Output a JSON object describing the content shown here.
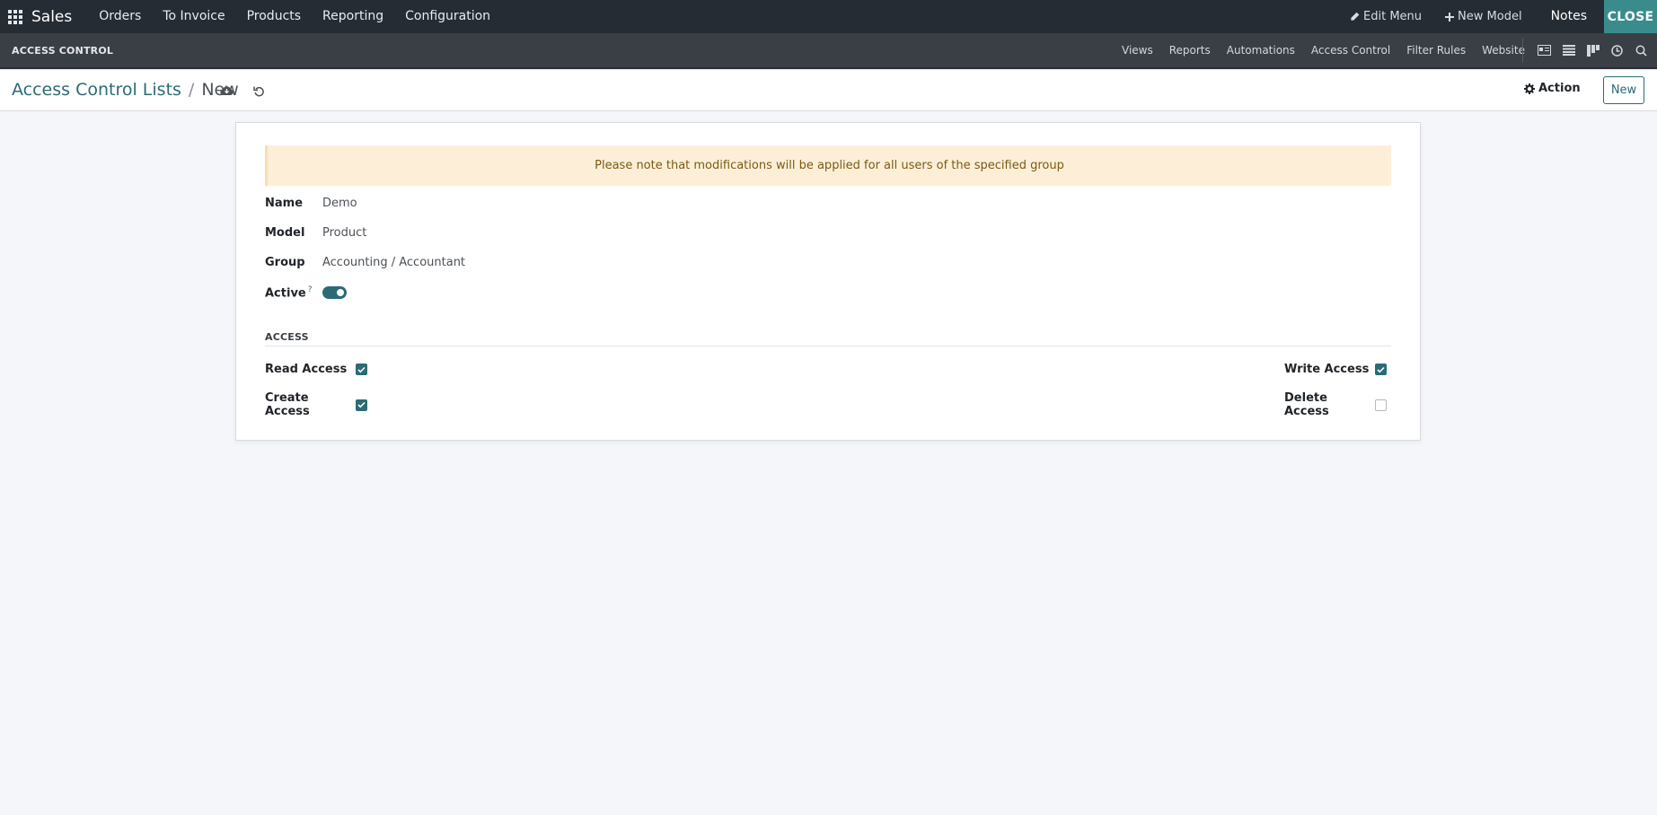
{
  "topbar": {
    "app_name": "Sales",
    "menu": [
      "Orders",
      "To Invoice",
      "Products",
      "Reporting",
      "Configuration"
    ],
    "edit_menu": "Edit Menu",
    "new_model": "New Model",
    "notes": "Notes",
    "close": "CLOSE"
  },
  "studio": {
    "title": "ACCESS CONTROL",
    "links": [
      "Views",
      "Reports",
      "Automations",
      "Access Control",
      "Filter Rules",
      "Website"
    ]
  },
  "control": {
    "breadcrumb_parent": "Access Control Lists",
    "breadcrumb_sep": "/",
    "breadcrumb_current": "New",
    "action_label": "Action",
    "new_label": "New"
  },
  "form": {
    "alert": "Please note that modifications will be applied for all users of the specified group",
    "name_label": "Name",
    "name_value": "Demo",
    "model_label": "Model",
    "model_value": "Product",
    "group_label": "Group",
    "group_value": "Accounting / Accountant",
    "active_label": "Active",
    "active_help": "?",
    "active_on": true,
    "section_title": "ACCESS",
    "read_label": "Read Access",
    "read_checked": true,
    "create_label": "Create Access",
    "create_checked": true,
    "write_label": "Write Access",
    "write_checked": true,
    "delete_label": "Delete Access",
    "delete_checked": false
  },
  "colors": {
    "primary": "#2b6b74",
    "topbar": "#262c34",
    "studiobar": "#3a3f46",
    "close": "#3a8c8c",
    "alert_bg": "#fdefd7"
  }
}
